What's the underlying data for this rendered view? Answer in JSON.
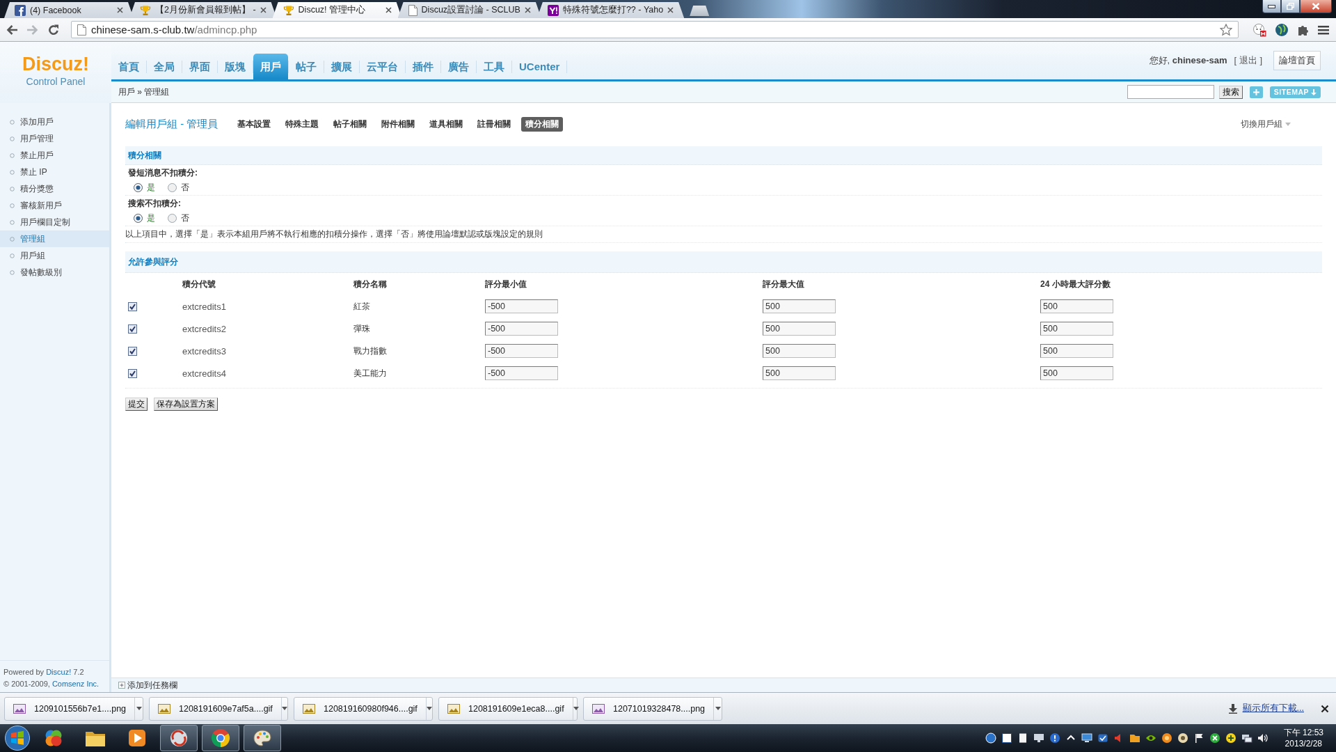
{
  "browser": {
    "tabs": [
      {
        "title": "(4) Facebook",
        "selected": false
      },
      {
        "title": "【2月份新會員報到帖】 -",
        "selected": false
      },
      {
        "title": "Discuz! 管理中心",
        "selected": true
      },
      {
        "title": "Discuz設置討論 - SCLUB",
        "selected": false
      },
      {
        "title": "特殊符號怎麼打?? - Yaho",
        "selected": false
      }
    ],
    "url": {
      "host": "chinese-sam.s-club.tw",
      "path": "/admincp.php"
    }
  },
  "header": {
    "logo": "Discuz!",
    "logo_subtitle": "Control Panel",
    "nav": [
      {
        "label": "首頁",
        "selected": false
      },
      {
        "label": "全局",
        "selected": false
      },
      {
        "label": "界面",
        "selected": false
      },
      {
        "label": "版塊",
        "selected": false
      },
      {
        "label": "用戶",
        "selected": true
      },
      {
        "label": "帖子",
        "selected": false
      },
      {
        "label": "擴展",
        "selected": false
      },
      {
        "label": "云平台",
        "selected": false
      },
      {
        "label": "插件",
        "selected": false
      },
      {
        "label": "廣告",
        "selected": false
      },
      {
        "label": "工具",
        "selected": false
      },
      {
        "label": "UCenter",
        "selected": false
      }
    ],
    "greeting": "您好, **chinese-sam**",
    "logout": "[ 退出 ]",
    "forum_home": "論壇首頁"
  },
  "breadcrumb": "用戶 » 管理組",
  "search": {
    "button": "搜索",
    "sitemap": "SITEMAP"
  },
  "sidebar": {
    "items": [
      {
        "label": "添加用戶",
        "selected": false
      },
      {
        "label": "用戶管理",
        "selected": false
      },
      {
        "label": "禁止用戶",
        "selected": false
      },
      {
        "label": "禁止 IP",
        "selected": false
      },
      {
        "label": "積分獎懲",
        "selected": false
      },
      {
        "label": "審核新用戶",
        "selected": false
      },
      {
        "label": "用戶欄目定制",
        "selected": false
      },
      {
        "label": "管理組",
        "selected": true
      },
      {
        "label": "用戶組",
        "selected": false
      },
      {
        "label": "發帖數級別",
        "selected": false
      }
    ],
    "powered": {
      "prefix": "Powered by",
      "link": "Discuz!",
      "suffix": "7.2"
    },
    "copyright": {
      "prefix": "© 2001-2009,",
      "link": "Comsenz Inc."
    }
  },
  "content": {
    "title": "編輯用戶組 - 管理員",
    "tabs": [
      {
        "label": "基本設置",
        "selected": false
      },
      {
        "label": "特殊主題",
        "selected": false
      },
      {
        "label": "帖子相關",
        "selected": false
      },
      {
        "label": "附件相關",
        "selected": false
      },
      {
        "label": "道具相關",
        "selected": false
      },
      {
        "label": "註冊相關",
        "selected": false
      },
      {
        "label": "積分相關",
        "selected": true
      }
    ],
    "switch_group": "切換用戶組",
    "credit_section": {
      "title": "積分相關",
      "settings": [
        {
          "label": "發短消息不扣積分:",
          "options": [
            {
              "label": "是",
              "selected": true
            },
            {
              "label": "否",
              "selected": false
            }
          ]
        },
        {
          "label": "搜索不扣積分:",
          "options": [
            {
              "label": "是",
              "selected": true
            },
            {
              "label": "否",
              "selected": false
            }
          ]
        }
      ],
      "note": "以上項目中，選擇「是」表示本組用戶將不執行相應的扣積分操作，選擇「否」將使用論壇默認或版塊設定的規則"
    },
    "rating_section": {
      "title": "允許參與評分",
      "columns": [
        "積分代號",
        "積分名稱",
        "評分最小值",
        "評分最大值",
        "24 小時最大評分數"
      ],
      "rows": [
        {
          "checked": true,
          "code": "extcredits1",
          "name": "紅茶",
          "min": "-500",
          "max": "500",
          "daily_max": "500"
        },
        {
          "checked": true,
          "code": "extcredits2",
          "name": "彈珠",
          "min": "-500",
          "max": "500",
          "daily_max": "500"
        },
        {
          "checked": true,
          "code": "extcredits3",
          "name": "戰力指數",
          "min": "-500",
          "max": "500",
          "daily_max": "500"
        },
        {
          "checked": true,
          "code": "extcredits4",
          "name": "美工能力",
          "min": "-500",
          "max": "500",
          "daily_max": "500"
        }
      ]
    },
    "buttons": [
      "提交",
      "保存為設置方案"
    ]
  },
  "bottom_bar": {
    "link": "添加到任務欄"
  },
  "downloads": {
    "items": [
      {
        "name": "1209101556b7e1....png",
        "kind": "png"
      },
      {
        "name": "1208191609e7af5a....gif",
        "kind": "gif"
      },
      {
        "name": "120819160980f946....gif",
        "kind": "gif"
      },
      {
        "name": "1208191609e1eca8....gif",
        "kind": "gif"
      },
      {
        "name": "12071019328478....png",
        "kind": "png"
      }
    ],
    "show_all": "顯示所有下載..."
  },
  "taskbar": {
    "apps": [
      {
        "running": false
      },
      {
        "running": false
      },
      {
        "running": false
      },
      {
        "running": true
      },
      {
        "running": true
      },
      {
        "running": true
      }
    ],
    "clock": {
      "time": "下午 12:53",
      "date": "2013/2/28"
    }
  }
}
